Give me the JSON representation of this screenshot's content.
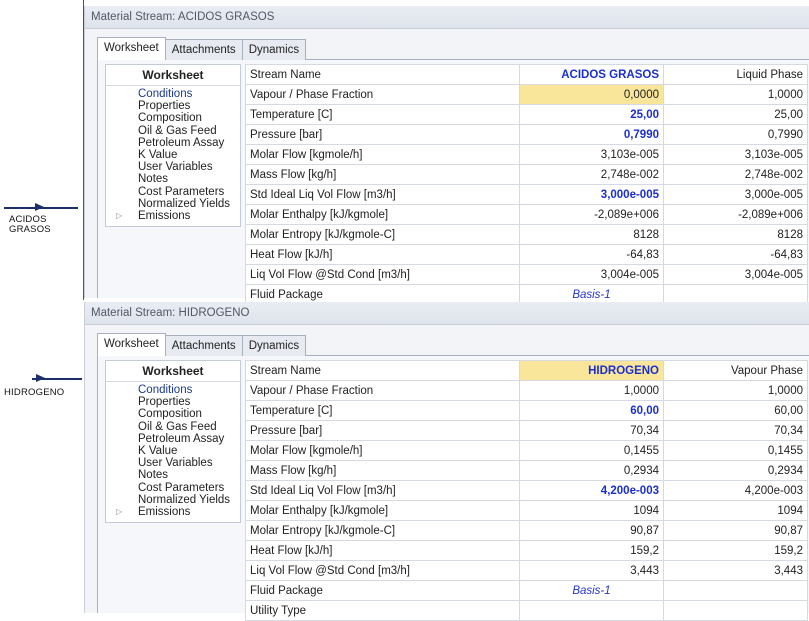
{
  "streams": {
    "acidos": {
      "label_line1": "ACIDOS",
      "label_line2": "GRASOS"
    },
    "hidrogeno": {
      "label": "HIDROGENO"
    }
  },
  "windows": [
    {
      "title": "Material Stream: ACIDOS GRASOS",
      "tabs": [
        "Worksheet",
        "Attachments",
        "Dynamics"
      ],
      "nav_header": "Worksheet",
      "nav_items": [
        "Conditions",
        "Properties",
        "Composition",
        "Oil & Gas Feed",
        "Petroleum Assay",
        "K Value",
        "User Variables",
        "Notes",
        "Cost Parameters",
        "Normalized Yields",
        "Emissions"
      ],
      "rows": [
        {
          "label": "Stream Name",
          "v1": "ACIDOS GRASOS",
          "v2": "Liquid Phase"
        },
        {
          "label": "Vapour / Phase Fraction",
          "v1": "0,0000",
          "v2": "1,0000"
        },
        {
          "label": "Temperature [C]",
          "v1": "25,00",
          "v2": "25,00"
        },
        {
          "label": "Pressure [bar]",
          "v1": "0,7990",
          "v2": "0,7990"
        },
        {
          "label": "Molar Flow [kgmole/h]",
          "v1": "3,103e-005",
          "v2": "3,103e-005"
        },
        {
          "label": "Mass Flow [kg/h]",
          "v1": "2,748e-002",
          "v2": "2,748e-002"
        },
        {
          "label": "Std Ideal Liq Vol Flow [m3/h]",
          "v1": "3,000e-005",
          "v2": "3,000e-005"
        },
        {
          "label": "Molar Enthalpy [kJ/kgmole]",
          "v1": "-2,089e+006",
          "v2": "-2,089e+006"
        },
        {
          "label": "Molar Entropy [kJ/kgmole-C]",
          "v1": "8128",
          "v2": "8128"
        },
        {
          "label": "Heat Flow [kJ/h]",
          "v1": "-64,83",
          "v2": "-64,83"
        },
        {
          "label": "Liq Vol Flow @Std Cond [m3/h]",
          "v1": "3,004e-005",
          "v2": "3,004e-005"
        },
        {
          "label": "Fluid Package",
          "v1": "Basis-1",
          "v2": ""
        }
      ]
    },
    {
      "title": "Material Stream: HIDROGENO",
      "tabs": [
        "Worksheet",
        "Attachments",
        "Dynamics"
      ],
      "nav_header": "Worksheet",
      "nav_items": [
        "Conditions",
        "Properties",
        "Composition",
        "Oil & Gas Feed",
        "Petroleum Assay",
        "K Value",
        "User Variables",
        "Notes",
        "Cost Parameters",
        "Normalized Yields",
        "Emissions"
      ],
      "rows": [
        {
          "label": "Stream Name",
          "v1": "HIDROGENO",
          "v2": "Vapour Phase"
        },
        {
          "label": "Vapour / Phase Fraction",
          "v1": "1,0000",
          "v2": "1,0000"
        },
        {
          "label": "Temperature [C]",
          "v1": "60,00",
          "v2": "60,00"
        },
        {
          "label": "Pressure [bar]",
          "v1": "70,34",
          "v2": "70,34"
        },
        {
          "label": "Molar Flow [kgmole/h]",
          "v1": "0,1455",
          "v2": "0,1455"
        },
        {
          "label": "Mass Flow [kg/h]",
          "v1": "0,2934",
          "v2": "0,2934"
        },
        {
          "label": "Std Ideal Liq Vol Flow [m3/h]",
          "v1": "4,200e-003",
          "v2": "4,200e-003"
        },
        {
          "label": "Molar Enthalpy [kJ/kgmole]",
          "v1": "1094",
          "v2": "1094"
        },
        {
          "label": "Molar Entropy [kJ/kgmole-C]",
          "v1": "90,87",
          "v2": "90,87"
        },
        {
          "label": "Heat Flow [kJ/h]",
          "v1": "159,2",
          "v2": "159,2"
        },
        {
          "label": "Liq Vol Flow @Std Cond [m3/h]",
          "v1": "3,443",
          "v2": "3,443"
        },
        {
          "label": "Fluid Package",
          "v1": "Basis-1",
          "v2": ""
        },
        {
          "label": "Utility Type",
          "v1": "",
          "v2": ""
        }
      ]
    }
  ]
}
